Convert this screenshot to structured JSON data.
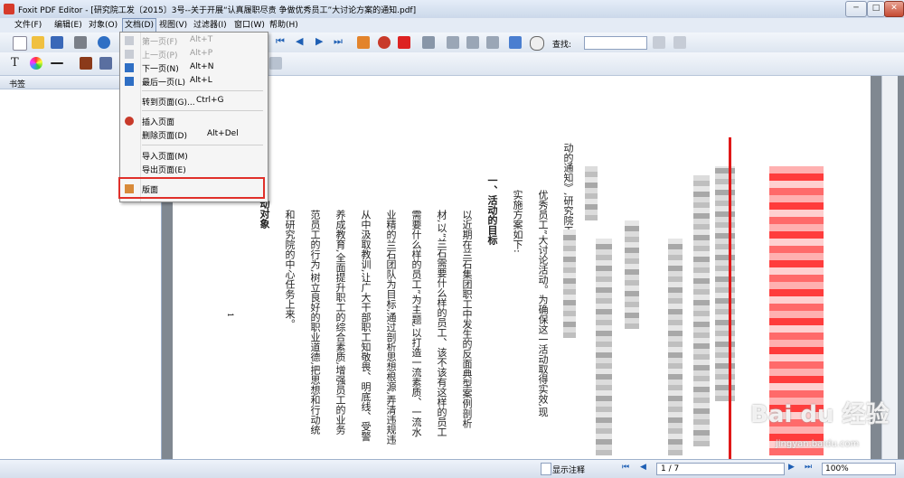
{
  "window": {
    "title": "Foxit PDF Editor - [研究院工发〔2015〕3号--关于开展“认真履职尽责 争做优秀员工”大讨论方案的通知.pdf]",
    "minimize": "─",
    "maximize": "□",
    "close": "✕"
  },
  "menubar": {
    "items": [
      "文件(F)",
      "编辑(E)",
      "对象(O)",
      "文档(D)",
      "视图(V)",
      "过滤器(I)",
      "窗口(W)",
      "帮助(H)"
    ]
  },
  "toolbar": {
    "search_label": "查找:",
    "search_value": ""
  },
  "left_panel": {
    "title": "书签"
  },
  "document_menu": {
    "items": [
      {
        "label": "第一页(F)",
        "shortcut": "Alt+T",
        "disabled": true
      },
      {
        "label": "上一页(P)",
        "shortcut": "Alt+P",
        "disabled": true
      },
      {
        "label": "下一页(N)",
        "shortcut": "Alt+N",
        "disabled": false
      },
      {
        "label": "最后一页(L)",
        "shortcut": "Alt+L",
        "disabled": false
      },
      {
        "label": "转到页面(G)...",
        "shortcut": "Ctrl+G",
        "disabled": false
      },
      {
        "label": "插入页面",
        "shortcut": "",
        "disabled": false
      },
      {
        "label": "删除页面(D)",
        "shortcut": "Alt+Del",
        "disabled": false
      },
      {
        "label": "导入页面(M)",
        "shortcut": "",
        "disabled": false
      },
      {
        "label": "导出页面(E)",
        "shortcut": "",
        "disabled": false
      },
      {
        "label": "版面",
        "shortcut": "",
        "disabled": false
      }
    ]
  },
  "document": {
    "columns": [
      "实施方案如下:",
      "一、活动的目标",
      "以近期在兰石集团职工中发生的反面典型案例剖析",
      "材,以“兰石需要什么样的员工、该不该有这样的员工",
      "需要什么样的员工”为主题,以打造一流素质、一流水",
      "业精的兰石团队为目标,通过剖析思想根源,弄清违规违",
      "从中汲取教训,让广大干部职工知敬畏、明底线、受警",
      "养成教育,全面提升职工的综合素质,增强员工的业务",
      "范员工的行为,树立良好的职业道德,把思想和行动统",
      "和研究院的中心任务上来。",
      "动对象"
    ],
    "partial_columns": [
      "优秀员工”大讨论活动。为确保这一活动取得实效,现",
      "动的通知》,研究院工"
    ],
    "page_number": "1"
  },
  "statusbar": {
    "show_annotations": "显示注释",
    "page_indicator": "1 / 7",
    "zoom": "100%"
  },
  "watermark": {
    "text": "Bai du 经验",
    "sub": "jingyan.baidu.com"
  }
}
